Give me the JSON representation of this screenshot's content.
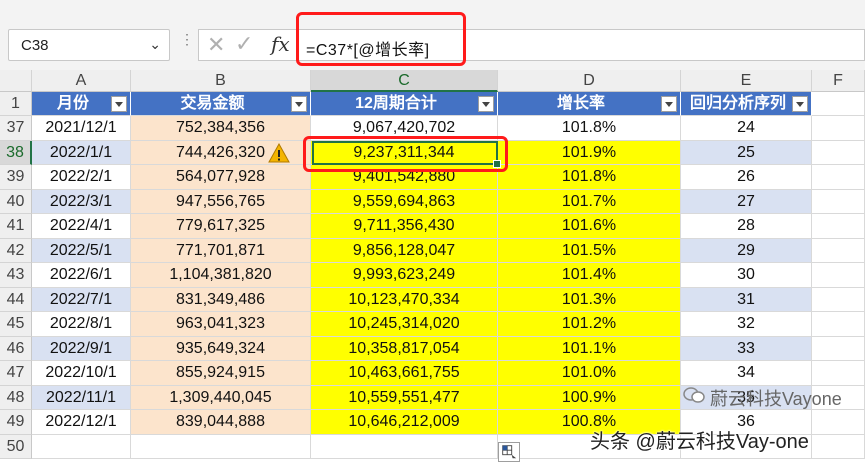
{
  "formula_bar": {
    "name_box": "C38",
    "formula": "=C37*[@增长率]"
  },
  "columns": [
    "A",
    "B",
    "C",
    "D",
    "E",
    "F"
  ],
  "table": {
    "headers": [
      "月份",
      "交易金额",
      "12周期合计",
      "增长率",
      "回归分析序列"
    ],
    "rows": [
      {
        "row": "37",
        "cells": [
          "2021/12/1",
          "752,384,356",
          "9,067,420,702",
          "101.8%",
          "24"
        ]
      },
      {
        "row": "38",
        "cells": [
          "2022/1/1",
          "744,426,320",
          "9,237,311,344",
          "101.9%",
          "25"
        ]
      },
      {
        "row": "39",
        "cells": [
          "2022/2/1",
          "564,077,928",
          "9,401,542,880",
          "101.8%",
          "26"
        ]
      },
      {
        "row": "40",
        "cells": [
          "2022/3/1",
          "947,556,765",
          "9,559,694,863",
          "101.7%",
          "27"
        ]
      },
      {
        "row": "41",
        "cells": [
          "2022/4/1",
          "779,617,325",
          "9,711,356,430",
          "101.6%",
          "28"
        ]
      },
      {
        "row": "42",
        "cells": [
          "2022/5/1",
          "771,701,871",
          "9,856,128,047",
          "101.5%",
          "29"
        ]
      },
      {
        "row": "43",
        "cells": [
          "2022/6/1",
          "1,104,381,820",
          "9,993,623,249",
          "101.4%",
          "30"
        ]
      },
      {
        "row": "44",
        "cells": [
          "2022/7/1",
          "831,349,486",
          "10,123,470,334",
          "101.3%",
          "31"
        ]
      },
      {
        "row": "45",
        "cells": [
          "2022/8/1",
          "963,041,323",
          "10,245,314,020",
          "101.2%",
          "32"
        ]
      },
      {
        "row": "46",
        "cells": [
          "2022/9/1",
          "935,649,324",
          "10,358,817,054",
          "101.1%",
          "33"
        ]
      },
      {
        "row": "47",
        "cells": [
          "2022/10/1",
          "855,924,915",
          "10,463,661,755",
          "101.0%",
          "34"
        ]
      },
      {
        "row": "48",
        "cells": [
          "2022/11/1",
          "1,309,440,045",
          "10,559,551,477",
          "100.9%",
          "35"
        ]
      },
      {
        "row": "49",
        "cells": [
          "2022/12/1",
          "839,044,888",
          "10,646,212,009",
          "100.8%",
          "36"
        ]
      },
      {
        "row": "50",
        "cells": [
          "",
          "",
          "",
          "",
          ""
        ]
      }
    ]
  },
  "colors": {
    "header_blue": "#4472c4",
    "peach": "#fce4cc",
    "yellow": "#ffff00",
    "lavender": "#d9e1f2",
    "highlight_red": "#ff1a1a",
    "excel_green": "#217346"
  },
  "watermark": {
    "line1": "蔚云科技Vayone",
    "line2": "头条 @蔚云科技Vay-one"
  }
}
